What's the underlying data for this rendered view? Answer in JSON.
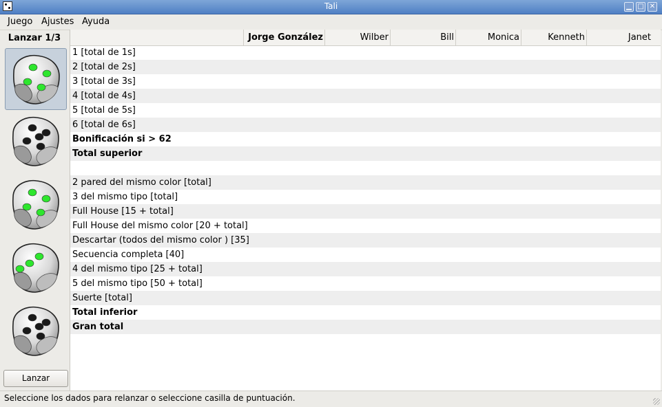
{
  "window": {
    "title": "Tali"
  },
  "menu": {
    "items": [
      "Juego",
      "Ajustes",
      "Ayuda"
    ]
  },
  "left": {
    "roll_status": "Lanzar 1/3",
    "roll_button": "Lanzar",
    "dice": [
      {
        "value": 4,
        "color": "green",
        "selected": true
      },
      {
        "value": 5,
        "color": "black",
        "selected": false
      },
      {
        "value": 4,
        "color": "green",
        "selected": false
      },
      {
        "value": 3,
        "color": "green",
        "selected": false
      },
      {
        "value": 5,
        "color": "black",
        "selected": false
      }
    ]
  },
  "players": [
    "Jorge González",
    "Wilber",
    "Bill",
    "Monica",
    "Kenneth",
    "Janet"
  ],
  "rows": [
    {
      "label": "1 [total de 1s]",
      "bold": false
    },
    {
      "label": "2 [total de 2s]",
      "bold": false
    },
    {
      "label": "3 [total de 3s]",
      "bold": false
    },
    {
      "label": "4 [total de 4s]",
      "bold": false
    },
    {
      "label": "5 [total de 5s]",
      "bold": false
    },
    {
      "label": "6 [total de 6s]",
      "bold": false
    },
    {
      "label": "Bonificación si > 62",
      "bold": true
    },
    {
      "label": "Total superior",
      "bold": true
    },
    {
      "label": "",
      "bold": false
    },
    {
      "label": "2 pared del mismo color [total]",
      "bold": false
    },
    {
      "label": "3 del mismo tipo [total]",
      "bold": false
    },
    {
      "label": "Full House [15 + total]",
      "bold": false
    },
    {
      "label": "Full House del mismo color [20 + total]",
      "bold": false
    },
    {
      "label": "Descartar (todos del mismo color ) [35]",
      "bold": false
    },
    {
      "label": "Secuencia completa [40]",
      "bold": false
    },
    {
      "label": "4 del mismo tipo [25 + total]",
      "bold": false
    },
    {
      "label": "5 del mismo tipo [50 + total]",
      "bold": false
    },
    {
      "label": "Suerte [total]",
      "bold": false
    },
    {
      "label": "Total inferior",
      "bold": true
    },
    {
      "label": "Gran total",
      "bold": true
    }
  ],
  "statusbar": {
    "text": "Seleccione los dados para relanzar o seleccione casilla de puntuación."
  },
  "colors": {
    "pip_green": "#2ee62e",
    "pip_black": "#1a1a1a",
    "titlebar": "#5a88c9"
  }
}
